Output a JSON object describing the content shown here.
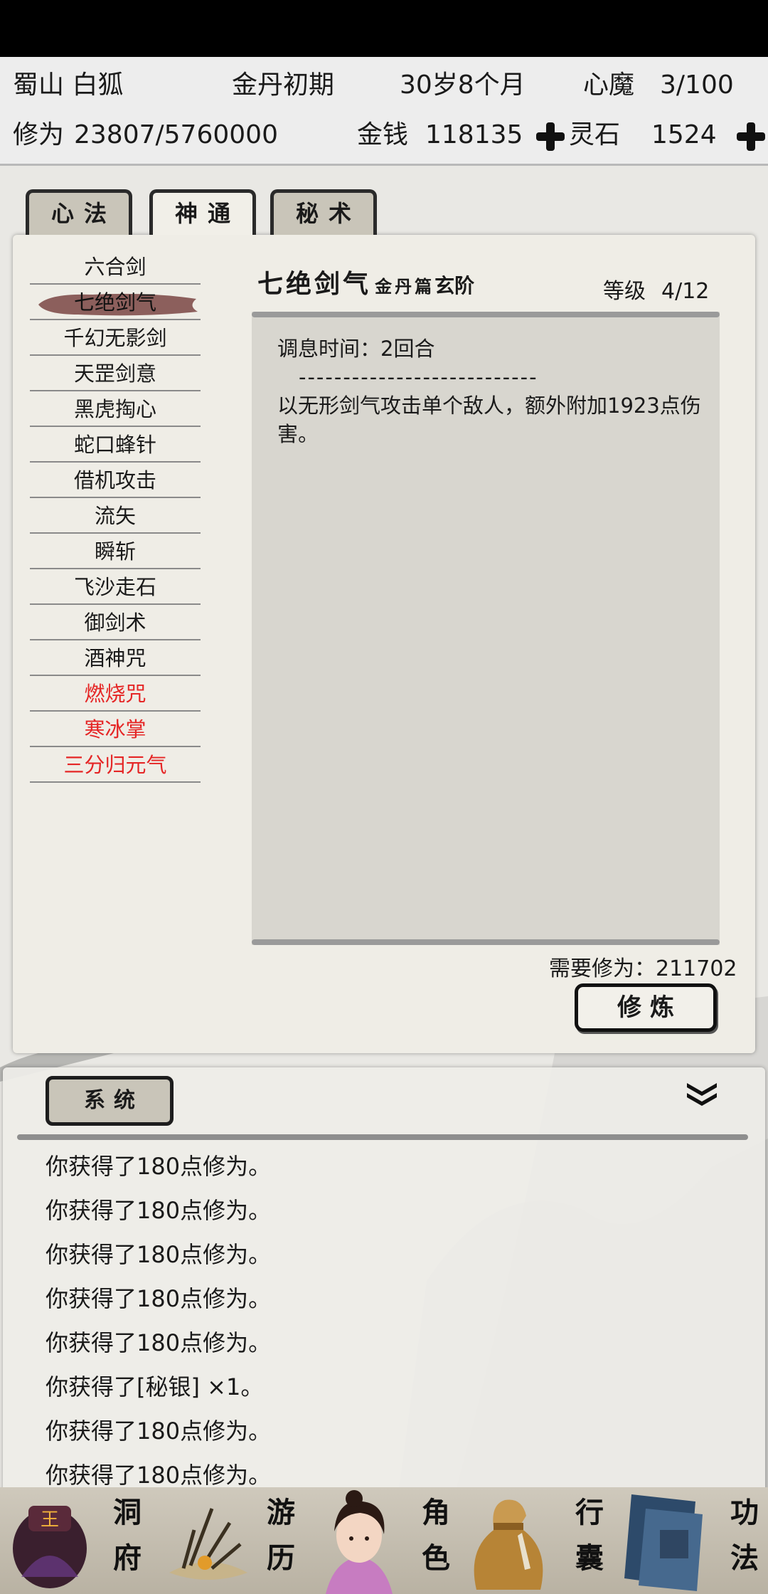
{
  "status": {
    "sect_name": "蜀山 白狐",
    "realm": "金丹初期",
    "age": "30岁8个月",
    "demon_label": "心魔",
    "demon_value": "3/100",
    "cultivation_label": "修为",
    "cultivation_value": "23807/5760000",
    "money_label": "金钱",
    "money_value": "118135",
    "stone_label": "灵石",
    "stone_value": "1524"
  },
  "tabs": [
    {
      "label": "心法",
      "active": false
    },
    {
      "label": "神通",
      "active": true
    },
    {
      "label": "秘术",
      "active": false
    }
  ],
  "skills": [
    {
      "name": "六合剑",
      "color": "#1a1a1a"
    },
    {
      "name": "七绝剑气",
      "color": "#1a1a1a",
      "selected": true
    },
    {
      "name": "千幻无影剑",
      "color": "#1a1a1a"
    },
    {
      "name": "天罡剑意",
      "color": "#1a1a1a"
    },
    {
      "name": "黑虎掏心",
      "color": "#1a1a1a"
    },
    {
      "name": "蛇口蜂针",
      "color": "#1a1a1a"
    },
    {
      "name": "借机攻击",
      "color": "#1a1a1a"
    },
    {
      "name": "流矢",
      "color": "#1a1a1a"
    },
    {
      "name": "瞬斩",
      "color": "#1a1a1a"
    },
    {
      "name": "飞沙走石",
      "color": "#1a1a1a"
    },
    {
      "name": "御剑术",
      "color": "#1a1a1a"
    },
    {
      "name": "酒神咒",
      "color": "#1a1a1a"
    },
    {
      "name": "燃烧咒",
      "color": "#e52626"
    },
    {
      "name": "寒冰掌",
      "color": "#e52626"
    },
    {
      "name": "三分归元气",
      "color": "#e52626"
    }
  ],
  "detail": {
    "name": "七绝剑气",
    "chapter": "金丹篇",
    "grade": "玄阶",
    "level_label": "等级",
    "level_value": "4/12",
    "cooldown": "调息时间：2回合",
    "divider": "---------------------------",
    "description": "以无形剑气攻击单个敌人，额外附加1923点伤害。",
    "required": "需要修为：211702",
    "practice_button": "修炼"
  },
  "log": {
    "tab_label": "系统",
    "entries": [
      "你获得了180点修为。",
      "你获得了180点修为。",
      "你获得了180点修为。",
      "你获得了180点修为。",
      "你获得了180点修为。",
      "你获得了[秘银] ×1。",
      "你获得了180点修为。",
      "你获得了180点修为。"
    ]
  },
  "nav": [
    {
      "label1": "洞",
      "label2": "府",
      "icon": "cave-icon"
    },
    {
      "label1": "游",
      "label2": "历",
      "icon": "travel-icon"
    },
    {
      "label1": "角",
      "label2": "色",
      "icon": "character-icon"
    },
    {
      "label1": "行",
      "label2": "囊",
      "icon": "bag-icon"
    },
    {
      "label1": "功",
      "label2": "法",
      "icon": "book-icon"
    }
  ],
  "colors": {
    "accent_red": "#e52626",
    "paper": "#efede6",
    "ink": "#1a1a1a"
  }
}
